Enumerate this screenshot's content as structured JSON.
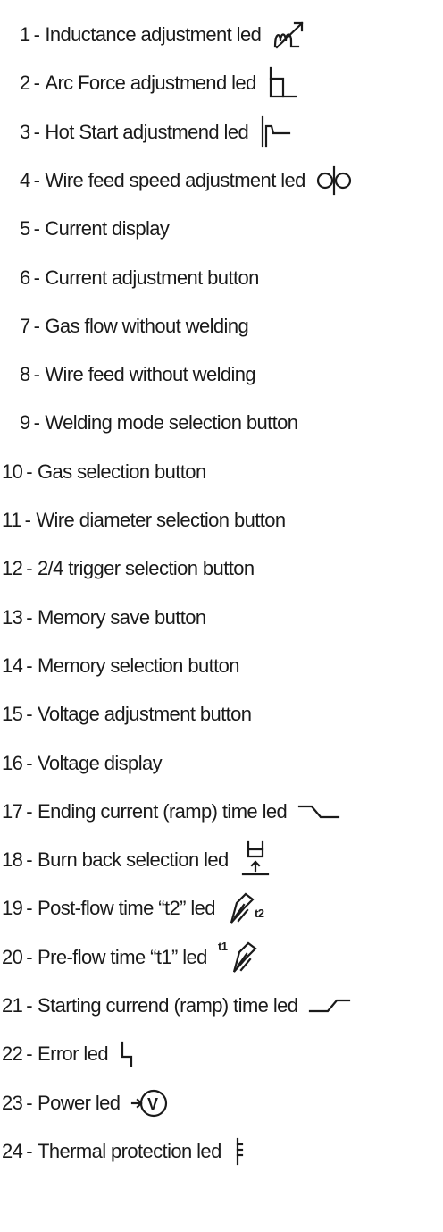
{
  "items": [
    {
      "num": "1",
      "label": "Inductance adjustment led",
      "icon": "inductance-icon"
    },
    {
      "num": "2",
      "label": "Arc Force adjustmend led",
      "icon": "arc-force-icon"
    },
    {
      "num": "3",
      "label": "Hot Start adjustmend led",
      "icon": "hot-start-icon"
    },
    {
      "num": "4",
      "label": "Wire feed speed adjustment led",
      "icon": "wire-feed-icon"
    },
    {
      "num": "5",
      "label": "Current display"
    },
    {
      "num": "6",
      "label": "Current adjustment button"
    },
    {
      "num": "7",
      "label": "Gas flow without welding"
    },
    {
      "num": "8",
      "label": "Wire feed without welding"
    },
    {
      "num": "9",
      "label": "Welding mode selection button"
    },
    {
      "num": "10",
      "label": "Gas selection button"
    },
    {
      "num": "11",
      "label": "Wire diameter selection button"
    },
    {
      "num": "12",
      "label": "2/4 trigger selection button"
    },
    {
      "num": "13",
      "label": "Memory save button"
    },
    {
      "num": "14",
      "label": "Memory selection button"
    },
    {
      "num": "15",
      "label": "Voltage adjustment button"
    },
    {
      "num": "16",
      "label": "Voltage display"
    },
    {
      "num": "17",
      "label": "Ending current (ramp) time led",
      "icon": "ramp-down-icon"
    },
    {
      "num": "18",
      "label": "Burn back selection led",
      "icon": "burn-back-icon"
    },
    {
      "num": "19",
      "label": "Post-flow time “t2” led",
      "icon": "post-flow-icon",
      "icon_text": "t2"
    },
    {
      "num": "20",
      "label": "Pre-flow time “t1” led",
      "icon": "pre-flow-icon",
      "icon_text": "t1"
    },
    {
      "num": "21",
      "label": "Starting currend (ramp) time led",
      "icon": "ramp-up-icon"
    },
    {
      "num": "22",
      "label": "Error led",
      "icon": "error-icon"
    },
    {
      "num": "23",
      "label": "Power led",
      "icon": "power-icon",
      "icon_text": "V"
    },
    {
      "num": "24",
      "label": "Thermal protection led",
      "icon": "thermal-icon"
    }
  ],
  "separator": "-"
}
